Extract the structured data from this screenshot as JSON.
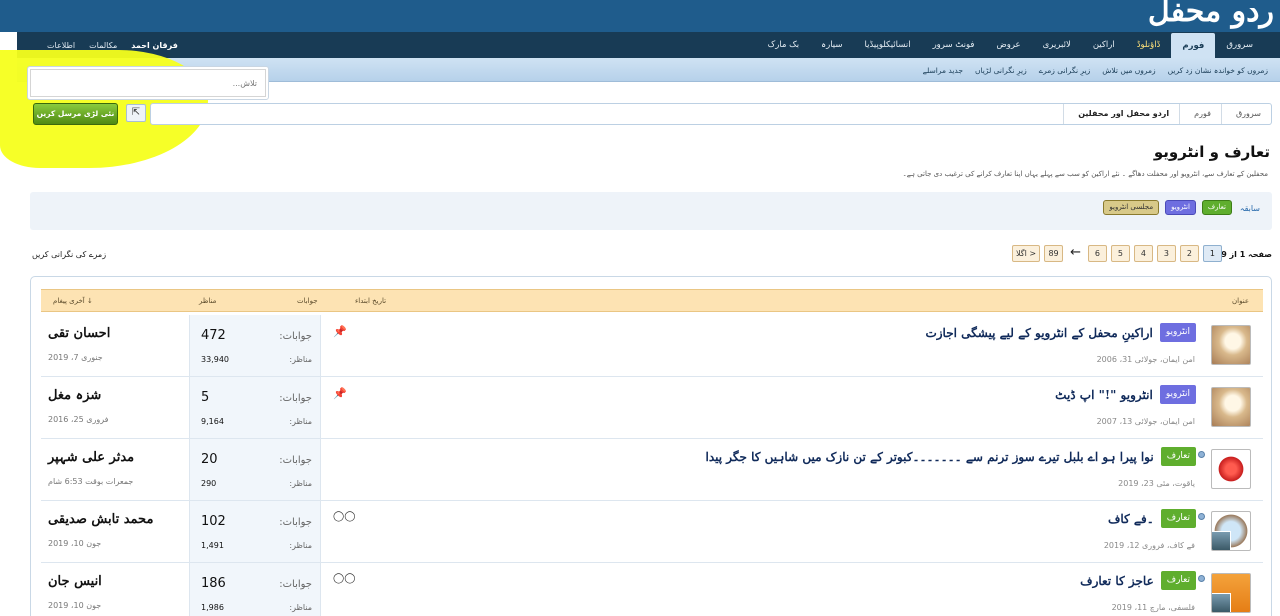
{
  "header": {
    "logo_text": "ردو محفل",
    "user_nav": [
      "اطلاعات",
      "مکالمات",
      "فرقان احمد"
    ],
    "tabs": [
      "سرورق",
      "فورم",
      "ڈاؤنلوڈ",
      "اراکین",
      "لائبریری",
      "عروض",
      "فونٹ سرور",
      "انسائیکلوپیڈیا",
      "سیارہ",
      "بک مارک"
    ],
    "active_tab": "فورم",
    "subnav": [
      "زمروں کو خواندہ نشان زد کریں",
      "زمروں میں تلاش",
      "زیرِ نگرانی زمرے",
      "زیرِ نگرانی لڑیاں",
      "جدید مراسلے"
    ]
  },
  "search": {
    "placeholder": "تلاش..."
  },
  "actions": {
    "post_new_thread": "نئی لڑی مرسل کریں",
    "external_icon": "external-link-icon"
  },
  "breadcrumb": [
    "سرورق",
    "فورم",
    "اردو محفل اور محفلین"
  ],
  "forum": {
    "title": "تعارف و انٹرویو",
    "description": "محفلین کے تعارف سے، انٹرویو اور محفلت دھاگے ۔ نئے اراکین کو سب سے پہلے یہاں اپنا تعارف کرانے کی ترغیب دی جاتی ہے۔"
  },
  "filter": {
    "label": "سابقہ",
    "prefixes": [
      "تعارف",
      "انٹرویو",
      "مجلسی انٹرویو"
    ]
  },
  "pagination": {
    "label": "صفحہ 1 از 89",
    "pages": [
      "1",
      "2",
      "3",
      "4",
      "5",
      "6"
    ],
    "arrow": "←",
    "last": "89",
    "next": "اگلا >",
    "watch_forum": "زمرے کی نگرانی کریں"
  },
  "columns": {
    "title": "عنوان",
    "start_date": "تاریخ ابتداء",
    "replies": "جوابات",
    "views": "مناظر",
    "last_post": "آخری پیغام ↓"
  },
  "labels": {
    "replies": "جوابات:",
    "views": "مناظر:"
  },
  "threads": [
    {
      "prefix": "انٹرویو",
      "prefix_color": "blue",
      "title": "اراکینِ محفل کے انٹرویو کے لیے پیشگی اجازت",
      "author_date": "امن ایمان، جولائی 31، 2006",
      "icon": "pin-icon",
      "avatar": "sand",
      "replies": "472",
      "views": "33,940",
      "last_user": "احسان تقی",
      "last_date": "جنوری 7، 2019"
    },
    {
      "prefix": "انٹرویو",
      "prefix_color": "blue",
      "title": "انٹرویو \"!\" اپ ڈیٹ",
      "author_date": "امن ایمان، جولائی 13، 2007",
      "icon": "pin-icon",
      "avatar": "sand",
      "replies": "5",
      "views": "9,164",
      "last_user": "شزہ مغل",
      "last_date": "فروری 25، 2016"
    },
    {
      "prefix": "تعارف",
      "prefix_color": "green",
      "title": "نوا پیرا ہو اے بلبل تیرے سوز ترنم سے ۔۔۔۔۔۔۔کبوتر کے تن نازک میں شاہیں کا جگر پیدا",
      "author_date": "یاقوت، مئی 23، 2019",
      "icon": "",
      "avatar": "ruby",
      "replies": "20",
      "views": "290",
      "last_user": "مدثر علی شہپر",
      "last_date": "جمعرات بوقت 6:53 شام"
    },
    {
      "prefix": "تعارف",
      "prefix_color": "green",
      "title": "۔فے کاف",
      "author_date": "فے کاف، فروری 12، 2019",
      "icon": "glasses-icon",
      "avatar": "globe",
      "replies": "102",
      "views": "1,491",
      "last_user": "محمد تابش صدیقی",
      "last_date": "جون 10، 2019"
    },
    {
      "prefix": "تعارف",
      "prefix_color": "green",
      "title": "عاجز کا تعارف",
      "author_date": "فلسفی، مارچ 11، 2019",
      "icon": "glasses-icon",
      "avatar": "orange",
      "replies": "186",
      "views": "1,986",
      "last_user": "انیس جان",
      "last_date": "جون 10، 2019"
    }
  ]
}
